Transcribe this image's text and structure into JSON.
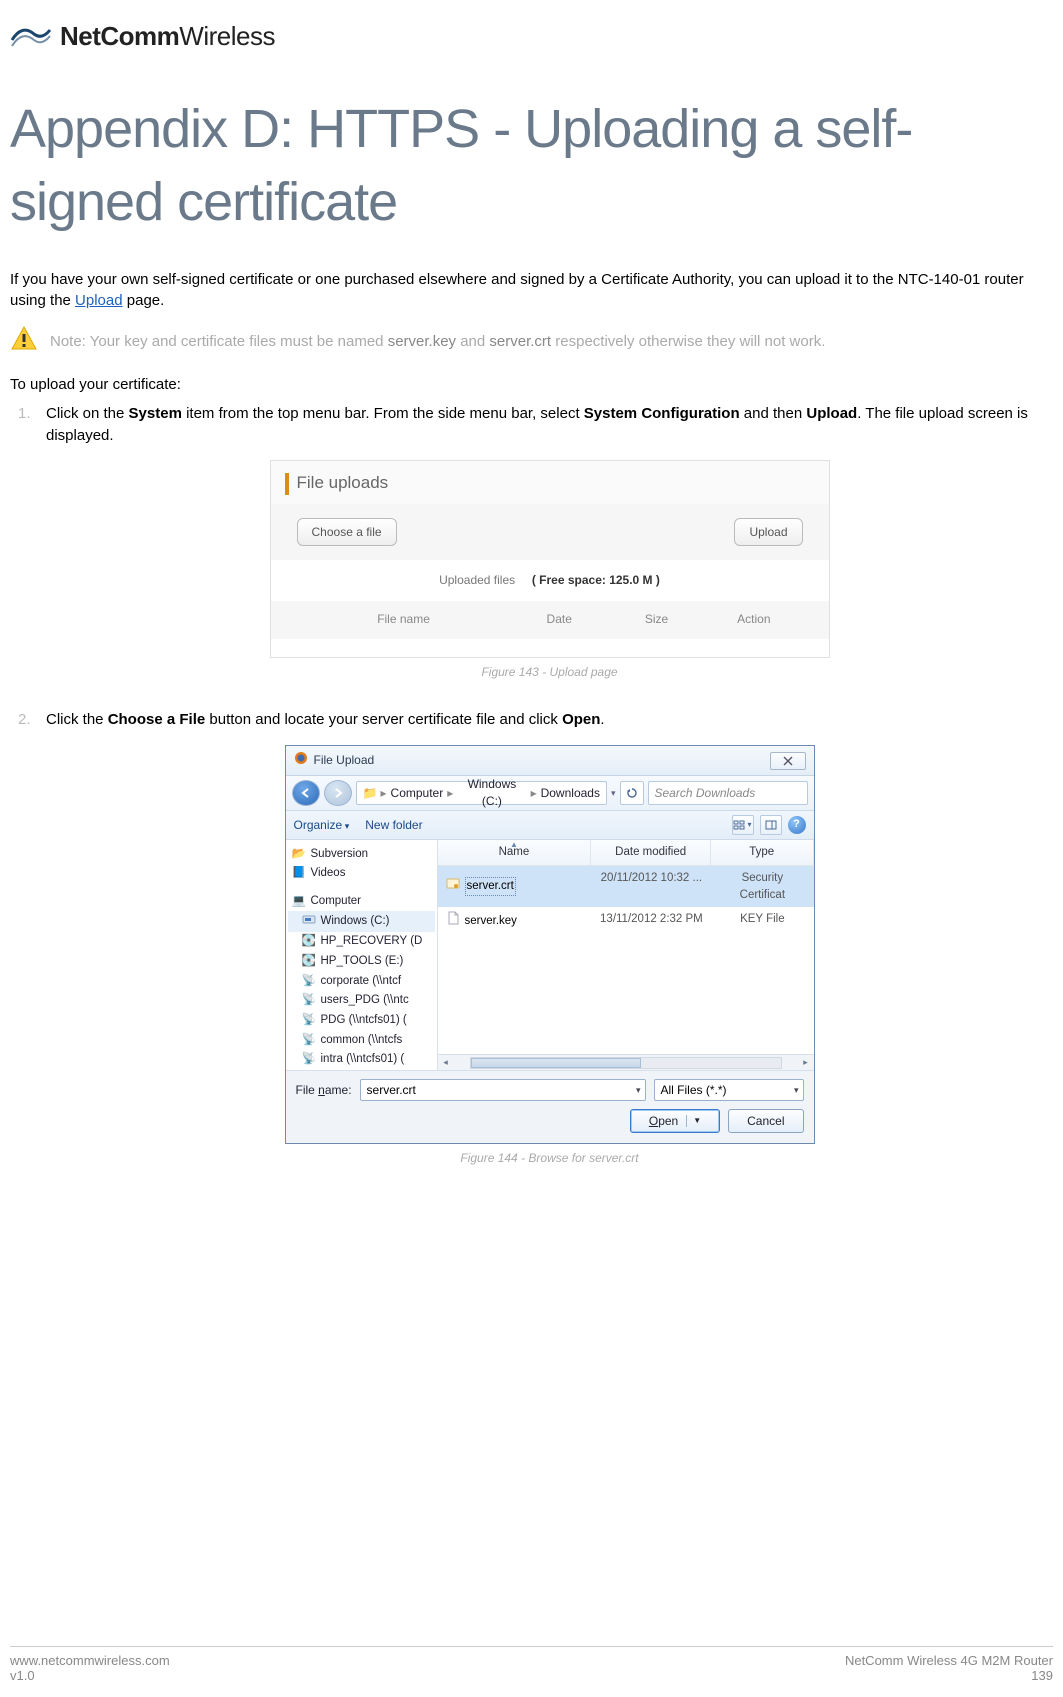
{
  "brand": {
    "bold": "NetComm",
    "light": "Wireless"
  },
  "title": "Appendix D: HTTPS - Uploading a self-signed certificate",
  "intro": {
    "pre": "If you have your own self-signed certificate or one purchased elsewhere and signed by a Certificate Authority, you can upload it to the NTC-140-01 router using the ",
    "link": "Upload",
    "post": " page."
  },
  "note": {
    "pre": "Note: Your key and certificate files must be named ",
    "f1": "server.key",
    "mid": " and ",
    "f2": "server.crt",
    "post": " respectively otherwise they will not work."
  },
  "upload_intro": "To upload your certificate:",
  "steps": {
    "s1": {
      "num": "1.",
      "a": "Click on the ",
      "b1": "System",
      "b": " item from the top menu bar. From the side menu bar, select ",
      "b2": "System Configuration",
      "c": " and then ",
      "b3": "Upload",
      "d": ". The file upload screen is displayed."
    },
    "s2": {
      "num": "2.",
      "a": "Click the ",
      "b1": "Choose a File",
      "b": " button and locate your server certificate file and click ",
      "b2": "Open",
      "c": "."
    }
  },
  "panel1": {
    "title": "File uploads",
    "choose": "Choose a file",
    "upload": "Upload",
    "uploaded_label": "Uploaded files",
    "free_space": "( Free space: 125.0 M )",
    "cols": {
      "name": "File name",
      "date": "Date",
      "size": "Size",
      "action": "Action"
    }
  },
  "caption1": "Figure 143 - Upload page",
  "dialog": {
    "title": "File Upload",
    "crumbs": [
      "Computer",
      "Windows  (C:)",
      "Downloads"
    ],
    "search_placeholder": "Search Downloads",
    "toolbar": {
      "organize": "Organize",
      "newfolder": "New folder"
    },
    "cols": {
      "name": "Name",
      "date": "Date modified",
      "type": "Type"
    },
    "tree": [
      "Subversion",
      "Videos",
      "",
      "Computer",
      "Windows  (C:)",
      "HP_RECOVERY (D",
      "HP_TOOLS (E:)",
      "corporate (\\\\ntcf",
      "users_PDG (\\\\ntc",
      "PDG (\\\\ntcfs01) (",
      "common (\\\\ntcfs",
      "intra (\\\\ntcfs01) ("
    ],
    "files": [
      {
        "name": "server.crt",
        "date": "20/11/2012 10:32 ...",
        "type": "Security Certificat",
        "sel": true,
        "icon": "cert"
      },
      {
        "name": "server.key",
        "date": "13/11/2012 2:32 PM",
        "type": "KEY File",
        "sel": false,
        "icon": "file"
      }
    ],
    "filename_label_pre": "File ",
    "filename_label_u": "n",
    "filename_label_post": "ame:",
    "filename_value": "server.crt",
    "filter": "All Files (*.*)",
    "open_u": "O",
    "open_rest": "pen",
    "cancel": "Cancel"
  },
  "caption2": "Figure 144 - Browse for server.crt",
  "footer": {
    "url": "www.netcommwireless.com",
    "ver": "v1.0",
    "product": "NetComm Wireless 4G M2M Router",
    "page": "139"
  }
}
